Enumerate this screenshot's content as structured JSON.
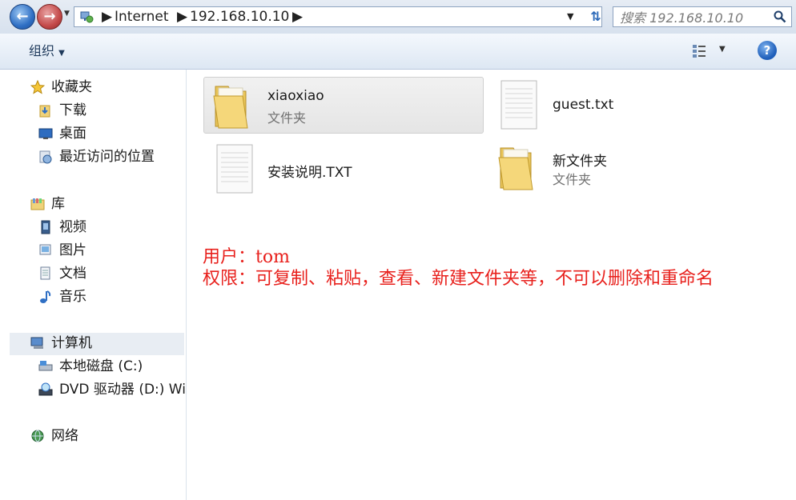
{
  "address_bar": {
    "segments": [
      "Internet",
      "192.168.10.10"
    ],
    "search_placeholder": "搜索 192.168.10.10"
  },
  "toolbar": {
    "organize_label": "组织"
  },
  "nav": {
    "favorites": {
      "header": "收藏夹",
      "items": [
        "下载",
        "桌面",
        "最近访问的位置"
      ]
    },
    "libraries": {
      "header": "库",
      "items": [
        "视频",
        "图片",
        "文档",
        "音乐"
      ]
    },
    "computer": {
      "header": "计算机",
      "items": [
        "本地磁盘 (C:)",
        "DVD 驱动器 (D:) Win"
      ]
    },
    "network": {
      "header": "网络"
    }
  },
  "content": {
    "items": [
      {
        "name": "xiaoxiao",
        "type": "文件夹",
        "icon": "folder-icon"
      },
      {
        "name": "guest.txt",
        "type": "",
        "icon": "text-file-icon"
      },
      {
        "name": "安装说明.TXT",
        "type": "",
        "icon": "text-file-icon"
      },
      {
        "name": "新文件夹",
        "type": "文件夹",
        "icon": "folder-icon"
      }
    ]
  },
  "overlay": {
    "line1": "用户：tom",
    "line2": "权限：可复制、粘贴，查看、新建文件夹等，不可以删除和重命名"
  },
  "colors": {
    "overlay_text": "#e8201c",
    "accent": "#2f6fc4"
  }
}
